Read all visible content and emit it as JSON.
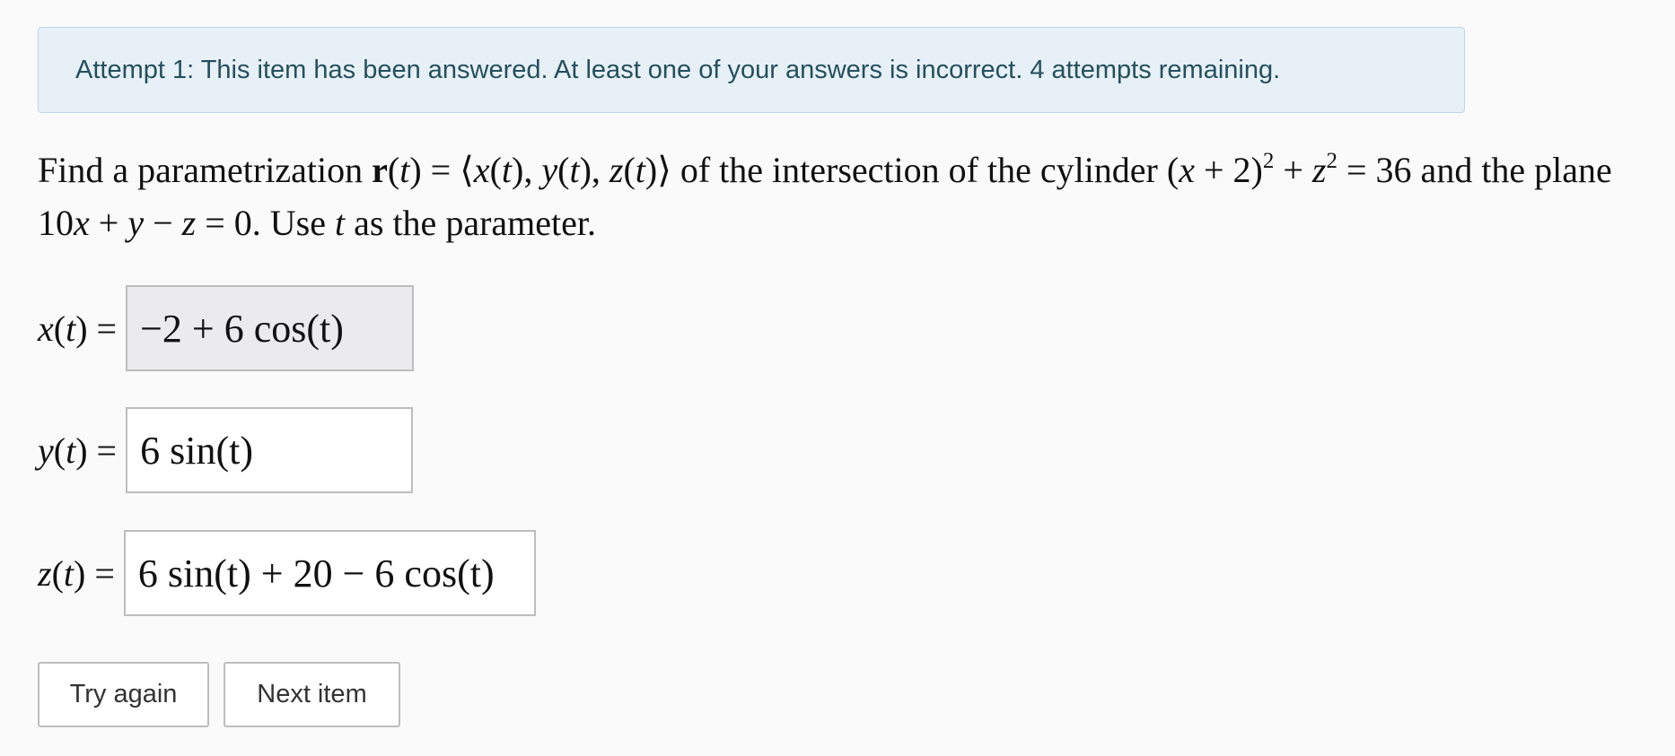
{
  "alert": {
    "message": "Attempt 1: This item has been answered. At least one of your answers is incorrect. 4 attempts remaining."
  },
  "problem": {
    "text_1": "Find a parametrization ",
    "r_symbol": "r",
    "text_2": "(",
    "t1": "t",
    "text_3": ") = ⟨",
    "x1": "x",
    "text_4": "(",
    "t2": "t",
    "text_5": "), ",
    "y1": "y",
    "text_6": "(",
    "t3": "t",
    "text_7": "), ",
    "z1": "z",
    "text_8": "(",
    "t4": "t",
    "text_9": ")⟩ of the intersection of the cylinder (",
    "x2": "x",
    "text_10": " + 2)",
    "exp1": "2",
    "text_11": " + ",
    "z2": "z",
    "exp2": "2",
    "text_12": " = 36 and the plane 10",
    "x3": "x",
    "text_13": " + ",
    "y2": "y",
    "text_14": " − ",
    "z3": "z",
    "text_15": " = 0. Use ",
    "t5": "t",
    "text_16": " as the parameter."
  },
  "answers": [
    {
      "var": "x",
      "arg": "t",
      "eq": ") = ",
      "value": "−2 + 6 cos(t)"
    },
    {
      "var": "y",
      "arg": "t",
      "eq": ") = ",
      "value": "6 sin(t)"
    },
    {
      "var": "z",
      "arg": "t",
      "eq": ") = ",
      "value": "6 sin(t) + 20 − 6 cos(t)"
    }
  ],
  "open_paren": "(",
  "buttons": {
    "try_again": "Try again",
    "next_item": "Next item"
  }
}
